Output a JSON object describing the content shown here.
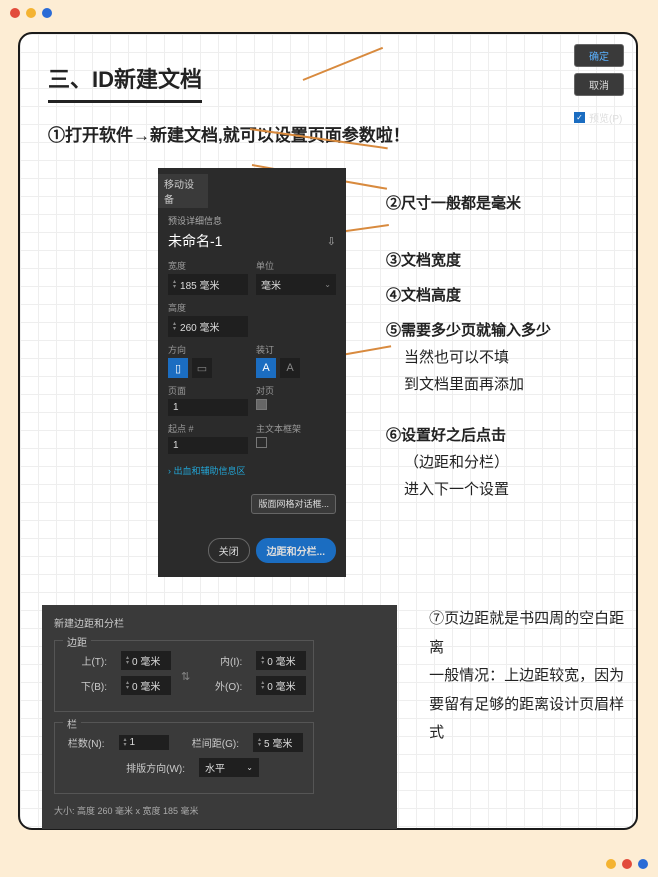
{
  "dots": {
    "red": "#e24b3b",
    "yellow": "#f4b331",
    "blue": "#2a6bd6"
  },
  "title": "三、ID新建文档",
  "intro": "①打开软件→新建文档,就可以设置页面参数啦！",
  "panel1": {
    "tab": "移动设备",
    "preset": "预设详细信息",
    "docname": "未命名-1",
    "width_lbl": "宽度",
    "width_val": "185 毫米",
    "unit_lbl": "单位",
    "unit_val": "毫米",
    "height_lbl": "高度",
    "height_val": "260 毫米",
    "orient_lbl": "方向",
    "bind_lbl": "装订",
    "pages_lbl": "页面",
    "pages_val": "1",
    "facing_lbl": "对页",
    "start_lbl": "起点 #",
    "start_val": "1",
    "primary_lbl": "主文本框架",
    "more": "› 出血和辅助信息区",
    "grid_btn": "版面网格对话框...",
    "close_btn": "关闭",
    "margin_btn": "边距和分栏..."
  },
  "ann": {
    "a2": "②尺寸一般都是毫米",
    "a3": "③文档宽度",
    "a4": "④文档高度",
    "a5": "⑤需要多少页就输入多少",
    "a5b": "当然也可以不填",
    "a5c": "到文档里面再添加",
    "a6": "⑥设置好之后点击",
    "a6b": "（边距和分栏）",
    "a6c": "进入下一个设置"
  },
  "panel2": {
    "title": "新建边距和分栏",
    "margin_box": "边距",
    "top_lbl": "上(T):",
    "top_val": "0 毫米",
    "bottom_lbl": "下(B):",
    "bottom_val": "0 毫米",
    "in_lbl": "内(I):",
    "in_val": "0 毫米",
    "out_lbl": "外(O):",
    "out_val": "0 毫米",
    "col_box": "栏",
    "cols_lbl": "栏数(N):",
    "cols_val": "1",
    "gutter_lbl": "栏间距(G):",
    "gutter_val": "5 毫米",
    "dir_lbl": "排版方向(W):",
    "dir_val": "水平",
    "ok": "确定",
    "cancel": "取消",
    "preview": "预览(P)",
    "foot": "大小: 高度 260 毫米 x 宽度 185 毫米"
  },
  "ann2": "⑦页边距就是书四周的空白距离\n一般情况：上边距较宽，因为要留有足够的距离设计页眉样式"
}
